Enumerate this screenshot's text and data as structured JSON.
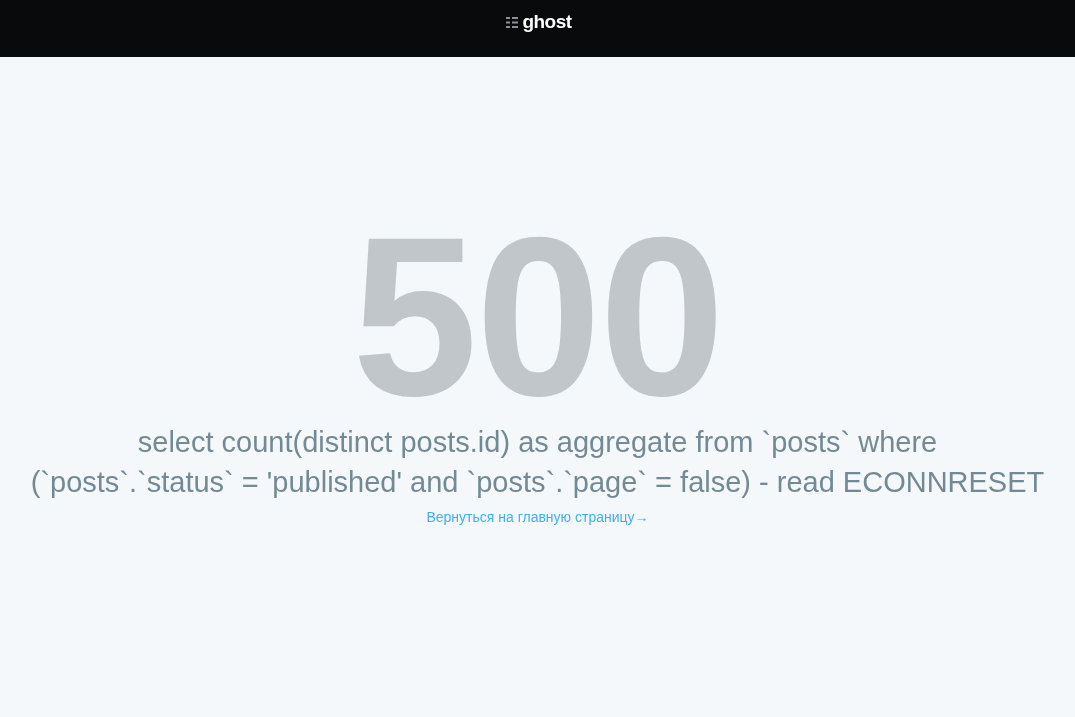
{
  "header": {
    "logo": {
      "text": "ghost"
    }
  },
  "error": {
    "code": "500",
    "message": "select count(distinct posts.id) as aggregate from `posts` where\n(`posts`.`status` = 'published' and `posts`.`page` = false) - read ECONNRESET"
  },
  "link": {
    "label": "Вернуться на главную страницу→"
  }
}
